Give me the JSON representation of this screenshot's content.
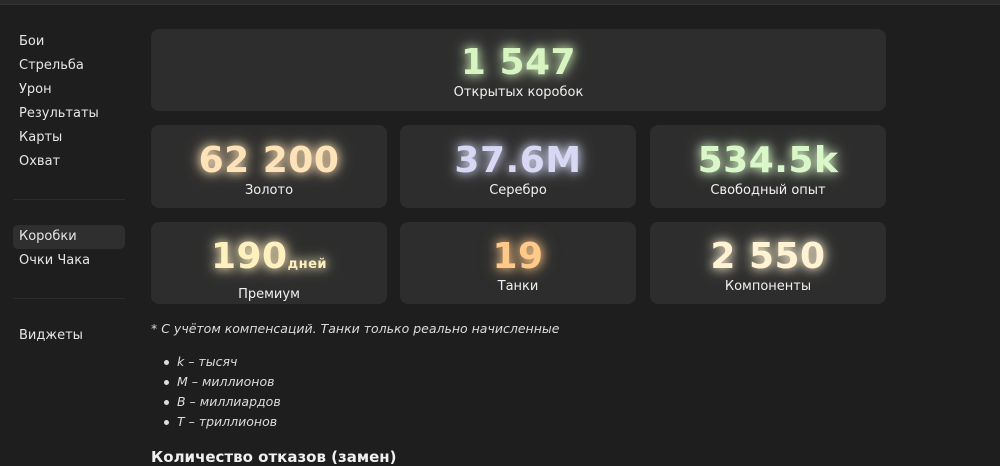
{
  "sidebar": {
    "group1": [
      "Бои",
      "Стрельба",
      "Урон",
      "Результаты",
      "Карты",
      "Охват"
    ],
    "group2": [
      "Коробки",
      "Очки Чака"
    ],
    "group3": [
      "Виджеты"
    ],
    "active": "Коробки"
  },
  "cards": {
    "boxes": {
      "value": "1 547",
      "label": "Открытых коробок",
      "color": "#d6f5c0"
    },
    "gold": {
      "value": "62 200",
      "label": "Золото",
      "color": "#ffe3b8"
    },
    "silver": {
      "value": "37.6M",
      "label": "Серебро",
      "color": "#d8d8f4"
    },
    "free_xp": {
      "value": "534.5k",
      "label": "Свободный опыт",
      "color": "#d9f7c8"
    },
    "premium": {
      "value": "190",
      "unit": "дней",
      "label": "Премиум",
      "color": "#fff0c0"
    },
    "tanks": {
      "value": "19",
      "label": "Танки",
      "color": "#ffc98a"
    },
    "components": {
      "value": "2 550",
      "label": "Компоненты",
      "color": "#fff3d4"
    }
  },
  "note": "* С учётом компенсаций. Танки только реально начисленные",
  "legend": [
    "k – тысяч",
    "M – миллионов",
    "B – миллиардов",
    "T – триллионов"
  ],
  "section_title": "Количество отказов (замен)"
}
